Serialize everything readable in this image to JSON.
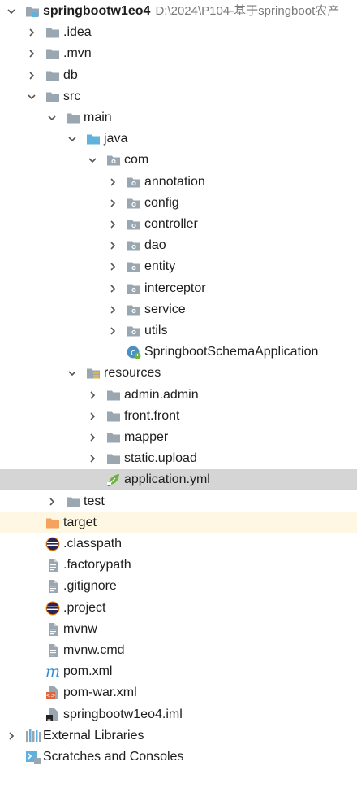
{
  "project": {
    "name": "springbootw1eo4",
    "path": "D:\\2024\\P104-基于springboot农产"
  },
  "nodes": [
    {
      "label": "springbootw1eo4",
      "level": 0,
      "arrow": "down",
      "icon": "module-folder-icon",
      "name": "tree-node-project-root"
    },
    {
      "label": ".idea",
      "level": 1,
      "arrow": "right",
      "icon": "folder-icon",
      "name": "tree-node-idea"
    },
    {
      "label": ".mvn",
      "level": 1,
      "arrow": "right",
      "icon": "folder-icon",
      "name": "tree-node-mvn"
    },
    {
      "label": "db",
      "level": 1,
      "arrow": "right",
      "icon": "folder-icon",
      "name": "tree-node-db"
    },
    {
      "label": "src",
      "level": 1,
      "arrow": "down",
      "icon": "folder-icon",
      "name": "tree-node-src"
    },
    {
      "label": "main",
      "level": 2,
      "arrow": "down",
      "icon": "folder-icon",
      "name": "tree-node-main"
    },
    {
      "label": "java",
      "level": 3,
      "arrow": "down",
      "icon": "source-folder-icon",
      "name": "tree-node-java"
    },
    {
      "label": "com",
      "level": 4,
      "arrow": "down",
      "icon": "package-icon",
      "name": "tree-node-com"
    },
    {
      "label": "annotation",
      "level": 5,
      "arrow": "right",
      "icon": "package-icon",
      "name": "tree-node-annotation"
    },
    {
      "label": "config",
      "level": 5,
      "arrow": "right",
      "icon": "package-icon",
      "name": "tree-node-config"
    },
    {
      "label": "controller",
      "level": 5,
      "arrow": "right",
      "icon": "package-icon",
      "name": "tree-node-controller"
    },
    {
      "label": "dao",
      "level": 5,
      "arrow": "right",
      "icon": "package-icon",
      "name": "tree-node-dao"
    },
    {
      "label": "entity",
      "level": 5,
      "arrow": "right",
      "icon": "package-icon",
      "name": "tree-node-entity"
    },
    {
      "label": "interceptor",
      "level": 5,
      "arrow": "right",
      "icon": "package-icon",
      "name": "tree-node-interceptor"
    },
    {
      "label": "service",
      "level": 5,
      "arrow": "right",
      "icon": "package-icon",
      "name": "tree-node-service"
    },
    {
      "label": "utils",
      "level": 5,
      "arrow": "right",
      "icon": "package-icon",
      "name": "tree-node-utils"
    },
    {
      "label": "SpringbootSchemaApplication",
      "level": 5,
      "arrow": "none",
      "icon": "spring-boot-class-icon",
      "name": "tree-node-springboot-schema-application"
    },
    {
      "label": "resources",
      "level": 3,
      "arrow": "down",
      "icon": "resources-folder-icon",
      "name": "tree-node-resources"
    },
    {
      "label": "admin.admin",
      "level": 4,
      "arrow": "right",
      "icon": "folder-icon",
      "name": "tree-node-admin-admin"
    },
    {
      "label": "front.front",
      "level": 4,
      "arrow": "right",
      "icon": "folder-icon",
      "name": "tree-node-front-front"
    },
    {
      "label": "mapper",
      "level": 4,
      "arrow": "right",
      "icon": "folder-icon",
      "name": "tree-node-mapper"
    },
    {
      "label": "static.upload",
      "level": 4,
      "arrow": "right",
      "icon": "folder-icon",
      "name": "tree-node-static-upload"
    },
    {
      "label": "application.yml",
      "level": 4,
      "arrow": "none",
      "icon": "spring-yml-icon",
      "name": "tree-node-application-yml",
      "selected": true
    },
    {
      "label": "test",
      "level": 2,
      "arrow": "right",
      "icon": "folder-icon",
      "name": "tree-node-test"
    },
    {
      "label": "target",
      "level": 1,
      "arrow": "none",
      "icon": "excluded-folder-icon",
      "name": "tree-node-target",
      "excluded": true
    },
    {
      "label": ".classpath",
      "level": 1,
      "arrow": "none",
      "icon": "eclipse-file-icon",
      "name": "tree-node-classpath"
    },
    {
      "label": ".factorypath",
      "level": 1,
      "arrow": "none",
      "icon": "text-file-icon",
      "name": "tree-node-factorypath"
    },
    {
      "label": ".gitignore",
      "level": 1,
      "arrow": "none",
      "icon": "text-file-icon",
      "name": "tree-node-gitignore"
    },
    {
      "label": ".project",
      "level": 1,
      "arrow": "none",
      "icon": "eclipse-file-icon",
      "name": "tree-node-project"
    },
    {
      "label": "mvnw",
      "level": 1,
      "arrow": "none",
      "icon": "text-file-icon",
      "name": "tree-node-mvnw"
    },
    {
      "label": "mvnw.cmd",
      "level": 1,
      "arrow": "none",
      "icon": "text-file-icon",
      "name": "tree-node-mvnw-cmd"
    },
    {
      "label": "pom.xml",
      "level": 1,
      "arrow": "none",
      "icon": "maven-icon",
      "name": "tree-node-pom-xml"
    },
    {
      "label": "pom-war.xml",
      "level": 1,
      "arrow": "none",
      "icon": "xml-file-icon",
      "name": "tree-node-pom-war-xml"
    },
    {
      "label": "springbootw1eo4.iml",
      "level": 1,
      "arrow": "none",
      "icon": "iml-file-icon",
      "name": "tree-node-iml"
    },
    {
      "label": "External Libraries",
      "level": 0,
      "arrow": "right",
      "icon": "libraries-icon",
      "name": "tree-node-external-libraries"
    },
    {
      "label": "Scratches and Consoles",
      "level": 0,
      "arrow": "none",
      "icon": "scratches-icon",
      "name": "tree-node-scratches"
    }
  ],
  "colors": {
    "folder": "#9aa7b0",
    "source_folder": "#62b0dd",
    "excluded_folder": "#f5a25d",
    "spring": "#6db33f",
    "maven": "#2f8cd8",
    "selection": "#d5d5d5",
    "excluded_row": "#fdf7e3"
  }
}
